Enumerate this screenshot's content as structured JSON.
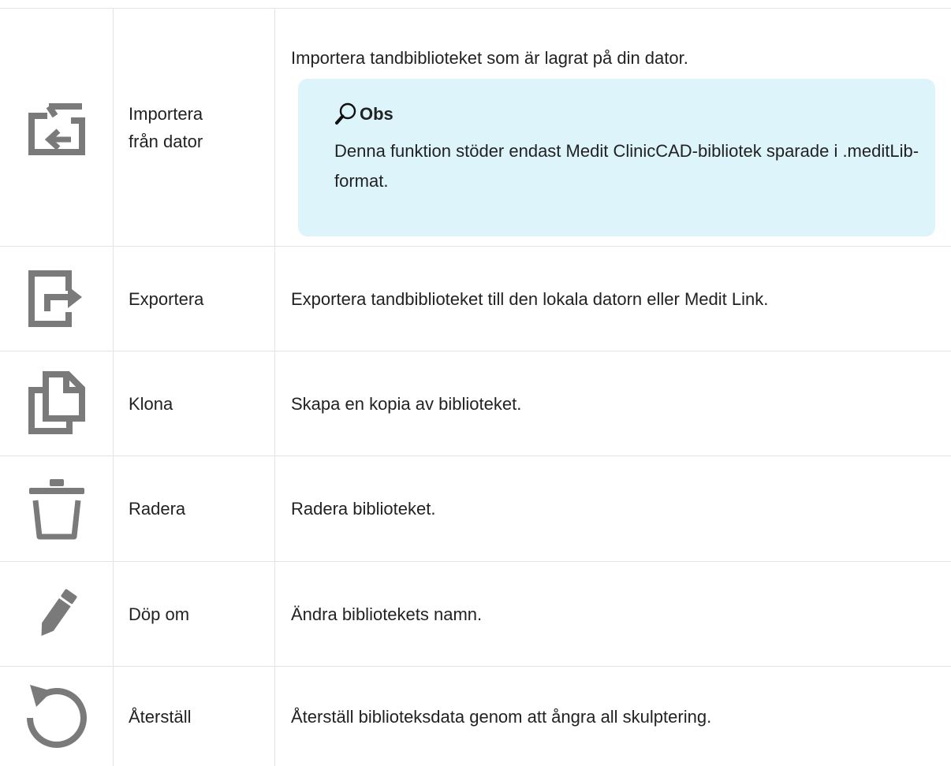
{
  "rows": [
    {
      "icon": "import-folder-icon",
      "name": "Importera från dator",
      "description": "Importera tandbiblioteket som är lagrat på din dator.",
      "note": {
        "icon": "magnifier-icon",
        "title": "Obs",
        "text": "Denna funktion stöder endast Medit ClinicCAD-bibliotek sparade i .meditLib-format."
      }
    },
    {
      "icon": "export-icon",
      "name": "Exportera",
      "description": "Exportera tandbiblioteket till den lokala datorn eller Medit Link."
    },
    {
      "icon": "clone-icon",
      "name": "Klona",
      "description": "Skapa en kopia av biblioteket."
    },
    {
      "icon": "trash-icon",
      "name": "Radera",
      "description": "Radera biblioteket."
    },
    {
      "icon": "pencil-icon",
      "name": "Döp om",
      "description": "Ändra bibliotekets namn."
    },
    {
      "icon": "reset-icon",
      "name": "Återställ",
      "description": "Återställ biblioteksdata genom att ångra all skulptering."
    }
  ],
  "colors": {
    "icon": "#7a7a7a",
    "note_background": "#ddf4fb",
    "border": "#e3e3e3",
    "text": "#222222"
  }
}
